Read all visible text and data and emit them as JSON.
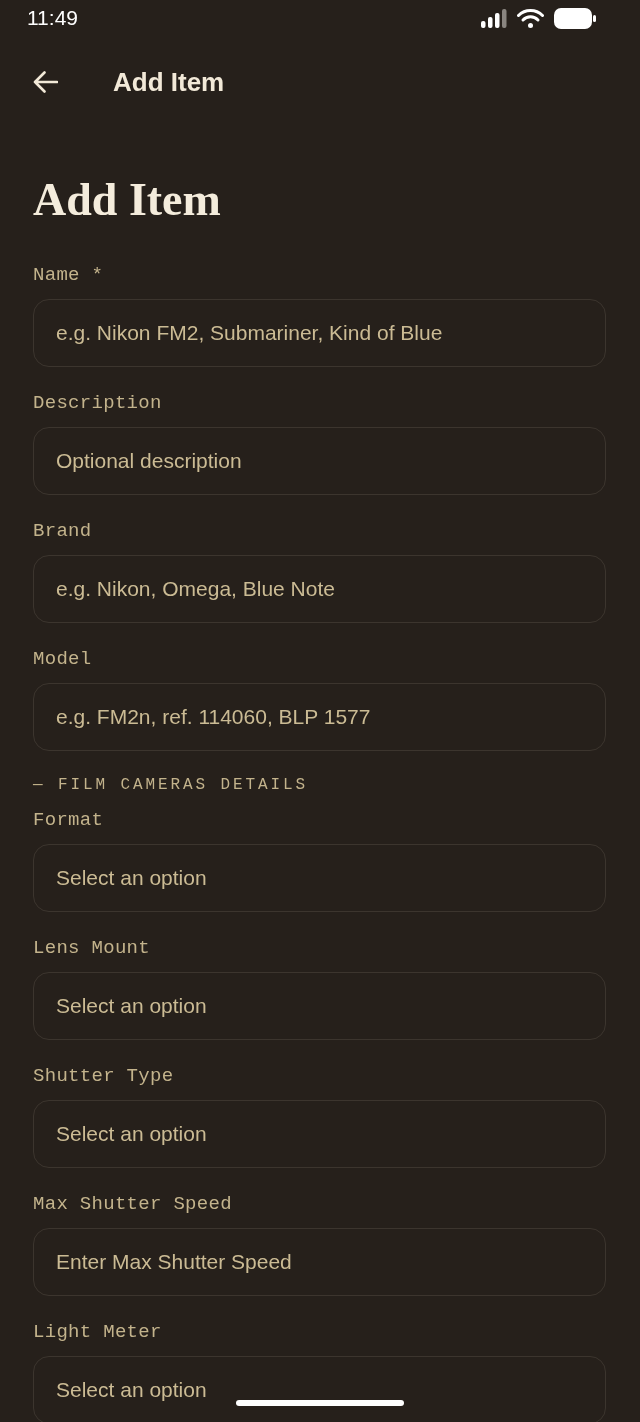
{
  "status_bar": {
    "time": "11:49"
  },
  "app_bar": {
    "title": "Add Item"
  },
  "form": {
    "heading": "Add Item",
    "fields": [
      {
        "label": "Name *",
        "placeholder": "e.g. Nikon FM2, Submariner, Kind of Blue"
      },
      {
        "label": "Description",
        "placeholder": "Optional description"
      },
      {
        "label": "Brand",
        "placeholder": "e.g. Nikon, Omega, Blue Note"
      },
      {
        "label": "Model",
        "placeholder": "e.g. FM2n, ref. 114060, BLP 1577"
      }
    ],
    "sections": [
      {
        "title": "— FILM CAMERAS DETAILS",
        "fields": [
          {
            "label": "Format",
            "placeholder": "Select an option"
          },
          {
            "label": "Lens Mount",
            "placeholder": "Select an option"
          },
          {
            "label": "Shutter Type",
            "placeholder": "Select an option"
          },
          {
            "label": "Max Shutter Speed",
            "placeholder": "Enter Max Shutter Speed"
          },
          {
            "label": "Light Meter",
            "placeholder": "Select an option"
          }
        ]
      }
    ]
  }
}
